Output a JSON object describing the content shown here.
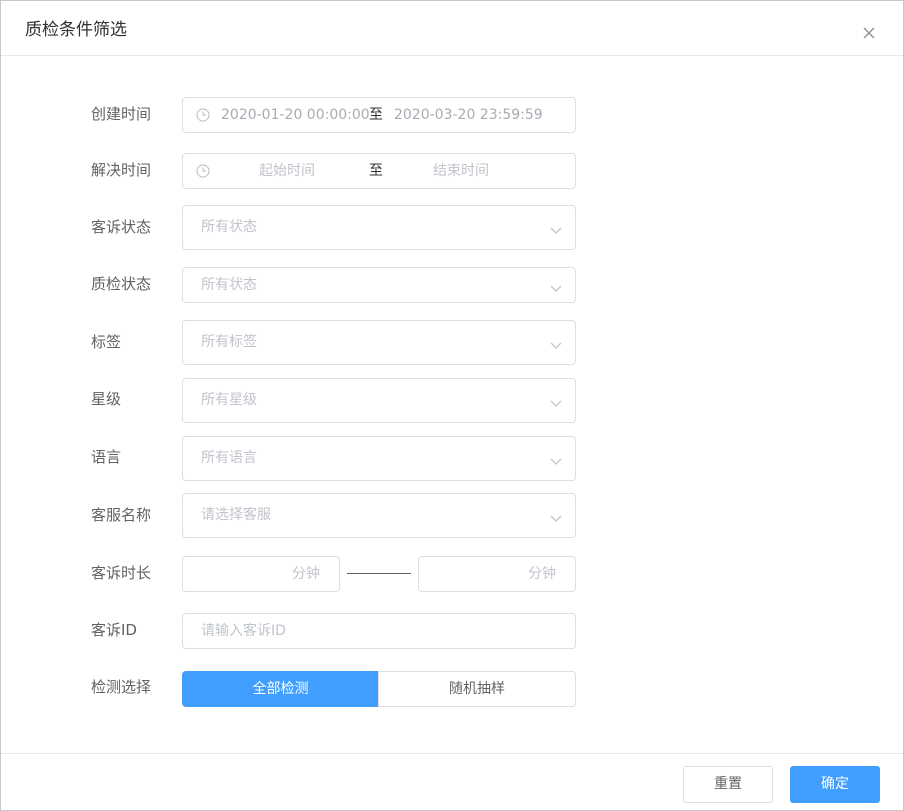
{
  "dialog": {
    "title": "质检条件筛选"
  },
  "form": {
    "create_time": {
      "label": "创建时间",
      "start": "2020-01-20 00:00:00",
      "sep": "至",
      "end": "2020-03-20 23:59:59"
    },
    "resolve_time": {
      "label": "解决时间",
      "start_placeholder": "起始时间",
      "sep": "至",
      "end_placeholder": "结束时间"
    },
    "complaint_status": {
      "label": "客诉状态",
      "placeholder": "所有状态"
    },
    "qc_status": {
      "label": "质检状态",
      "placeholder": "所有状态"
    },
    "tag": {
      "label": "标签",
      "placeholder": "所有标签"
    },
    "star": {
      "label": "星级",
      "placeholder": "所有星级"
    },
    "language": {
      "label": "语言",
      "placeholder": "所有语言"
    },
    "agent": {
      "label": "客服名称",
      "placeholder": "请选择客服"
    },
    "duration": {
      "label": "客诉时长",
      "unit": "分钟"
    },
    "complaint_id": {
      "label": "客诉ID",
      "placeholder": "请输入客诉ID"
    },
    "detection": {
      "label": "检测选择",
      "options": [
        "全部检测",
        "随机抽样"
      ],
      "selected": "全部检测"
    }
  },
  "footer": {
    "reset_label": "重置",
    "confirm_label": "确定"
  },
  "colors": {
    "primary": "#409eff",
    "border": "#dcdfe6",
    "placeholder": "#c0c4cc"
  }
}
